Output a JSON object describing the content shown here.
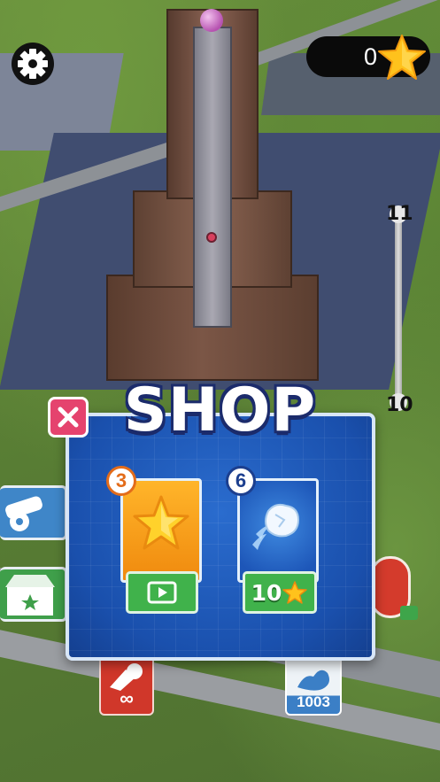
{
  "hud": {
    "settings_icon": "gear-icon",
    "score": "0",
    "score_icon": "star-icon"
  },
  "height_slider": {
    "max_label": "11",
    "min_label": "10"
  },
  "shop": {
    "title": "SHOP",
    "close_icon": "close-x-icon",
    "items": [
      {
        "name": "star",
        "icon": "star-icon",
        "count": "3",
        "action_icon": "video-play-icon"
      },
      {
        "name": "ice-ball",
        "icon": "ice-ball-icon",
        "count": "6",
        "price": "10",
        "price_icon": "star-icon"
      }
    ]
  },
  "side_buttons": {
    "cannon_icon": "cannon-icon",
    "chest_icon": "chest-icon",
    "fire_ammo": "∞",
    "ice_ammo": "1003"
  },
  "colors": {
    "dialog_blue": "#1a50ad",
    "close_pink": "#e5436e",
    "buy_green": "#40b24b",
    "star_orange": "#f08a0e"
  }
}
